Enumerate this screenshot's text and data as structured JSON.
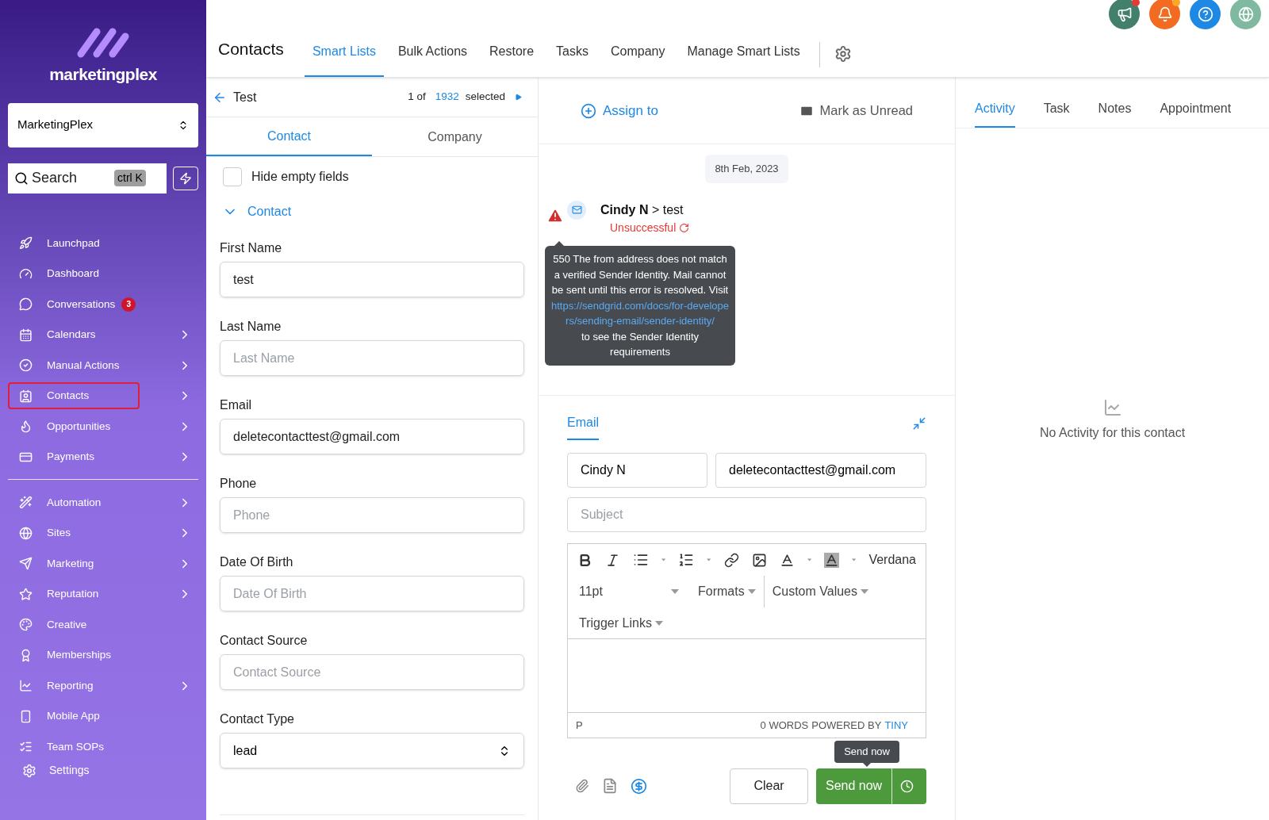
{
  "sidebar": {
    "brand": "marketingplex",
    "account": "MarketingPlex",
    "search": {
      "placeholder": "Search",
      "shortcut": "ctrl K"
    },
    "sections": [
      {
        "items": [
          {
            "label": "Launchpad",
            "expandable": false,
            "outlined": false
          },
          {
            "label": "Dashboard",
            "expandable": false,
            "outlined": false
          },
          {
            "label": "Conversations",
            "expandable": false,
            "outlined": false,
            "badge": "3"
          },
          {
            "label": "Calendars",
            "expandable": true,
            "outlined": false
          },
          {
            "label": "Manual Actions",
            "expandable": true,
            "outlined": false
          },
          {
            "label": "Contacts",
            "expandable": true,
            "outlined": true
          },
          {
            "label": "Opportunities",
            "expandable": true,
            "outlined": false
          },
          {
            "label": "Payments",
            "expandable": true,
            "outlined": false
          }
        ]
      },
      {
        "items": [
          {
            "label": "Automation",
            "expandable": true,
            "outlined": false
          },
          {
            "label": "Sites",
            "expandable": true,
            "outlined": false
          },
          {
            "label": "Marketing",
            "expandable": true,
            "outlined": false
          },
          {
            "label": "Reputation",
            "expandable": true,
            "outlined": false
          },
          {
            "label": "Creative",
            "expandable": false,
            "outlined": false
          },
          {
            "label": "Memberships",
            "expandable": false,
            "outlined": false
          },
          {
            "label": "Reporting",
            "expandable": true,
            "outlined": false
          },
          {
            "label": "Mobile App",
            "expandable": false,
            "outlined": false
          },
          {
            "label": "Team SOPs",
            "expandable": false,
            "outlined": false
          }
        ]
      }
    ],
    "settings": "Settings"
  },
  "top_icons": [
    {
      "dot": true,
      "color": "#e53935"
    },
    {
      "dot": true,
      "color": "#f9a825"
    },
    {
      "dot": false
    },
    {
      "dot": false
    }
  ],
  "header": {
    "title": "Contacts",
    "tabs": [
      {
        "label": "Smart Lists",
        "selected": true
      },
      {
        "label": "Bulk Actions",
        "selected": false
      },
      {
        "label": "Restore",
        "selected": false
      },
      {
        "label": "Tasks",
        "selected": false
      },
      {
        "label": "Company",
        "selected": false
      },
      {
        "label": "Manage Smart Lists",
        "selected": false
      }
    ]
  },
  "contact_panel": {
    "back": "Test",
    "counter": {
      "prefix": "1 of",
      "total": "1932",
      "suffix": "selected"
    },
    "tabs": [
      {
        "label": "Contact",
        "selected": true
      },
      {
        "label": "Company",
        "selected": false
      }
    ],
    "hide_empty": {
      "label": "Hide empty fields",
      "checked": false
    },
    "section": {
      "title": "Contact",
      "expanded": true
    },
    "fields": [
      {
        "kind": "text",
        "label": "First Name",
        "value": "test"
      },
      {
        "kind": "text",
        "label": "Last Name",
        "placeholder": "Last Name"
      },
      {
        "kind": "text",
        "label": "Email",
        "value": "deletecontacttest@gmail.com"
      },
      {
        "kind": "text",
        "label": "Phone",
        "placeholder": "Phone"
      },
      {
        "kind": "text",
        "label": "Date Of Birth",
        "placeholder": "Date Of Birth"
      },
      {
        "kind": "text",
        "label": "Contact Source",
        "placeholder": "Contact Source"
      },
      {
        "kind": "select",
        "label": "Contact Type",
        "value": "lead"
      }
    ]
  },
  "conversation": {
    "actions": {
      "assign": "Assign to",
      "unread": "Mark as Unread"
    },
    "date": "8th Feb, 2023",
    "message": {
      "from": "Cindy N",
      "separator": ">",
      "to": "test",
      "status": "Unsuccessful",
      "failed": true
    },
    "error_tooltip": {
      "text": "550 The from address does not match a verified Sender Identity. Mail cannot be sent until this error is resolved. Visit",
      "link": "https://sendgrid.com/docs/for-developers/sending-email/sender-identity/",
      "after": "to see the Sender Identity requirements"
    },
    "composer": {
      "tab": "Email",
      "from": "Cindy N",
      "to": "deletecontacttest@gmail.com",
      "subject_placeholder": "Subject",
      "font": "Verdana",
      "size": "11pt",
      "menus": [
        "Formats",
        "Custom Values",
        "Trigger Links"
      ],
      "status": {
        "element": "P",
        "words": "0 WORDS",
        "powered": "POWERED BY",
        "brand": "TINY"
      },
      "clear": "Clear",
      "send": "Send now",
      "send_tooltip": "Send now"
    }
  },
  "activity_panel": {
    "tabs": [
      {
        "label": "Activity",
        "selected": true
      },
      {
        "label": "Task",
        "selected": false
      },
      {
        "label": "Notes",
        "selected": false
      },
      {
        "label": "Appointment",
        "selected": false
      }
    ],
    "empty": "No Activity for this contact"
  }
}
